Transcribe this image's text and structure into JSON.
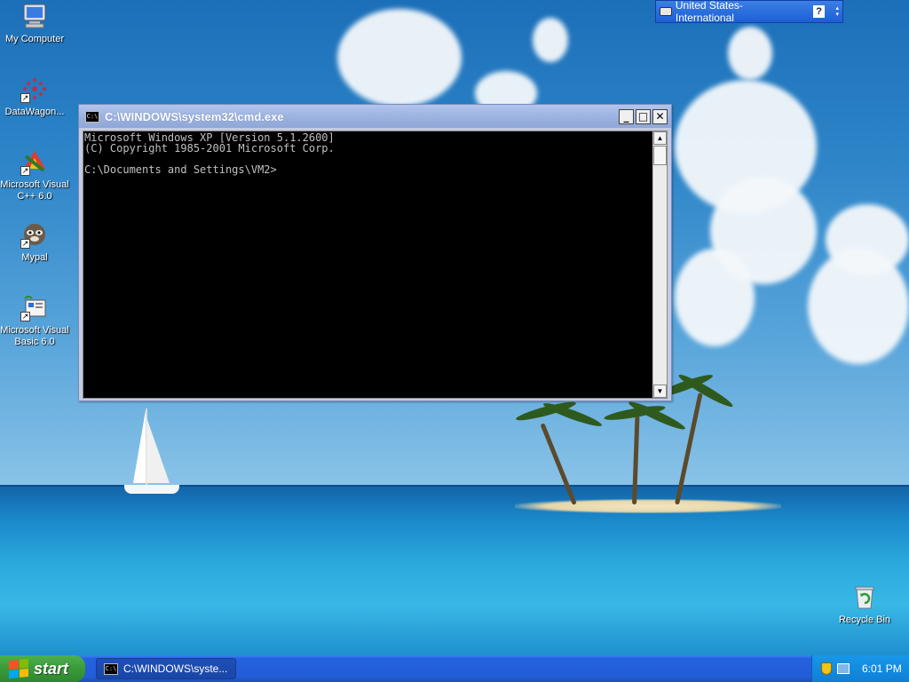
{
  "desktop": {
    "icons": [
      {
        "label": "My Computer",
        "icon": "computer-icon"
      },
      {
        "label": "DataWagon...",
        "icon": "datawagon-icon"
      },
      {
        "label": "Microsoft Visual C++ 6.0",
        "icon": "visual-cpp-icon"
      },
      {
        "label": "Mypal",
        "icon": "mypal-icon"
      },
      {
        "label": "Microsoft Visual Basic 6.0",
        "icon": "visual-basic-icon"
      }
    ],
    "recycle_bin": {
      "label": "Recycle Bin",
      "icon": "recycle-bin-icon"
    }
  },
  "language_bar": {
    "language": "United States-International",
    "help": "?"
  },
  "cmd_window": {
    "title": "C:\\WINDOWS\\system32\\cmd.exe",
    "title_icon_text": "C:\\",
    "buttons": {
      "minimize": "_",
      "maximize": "□",
      "close": "✕"
    },
    "console_lines": [
      "Microsoft Windows XP [Version 5.1.2600]",
      "(C) Copyright 1985-2001 Microsoft Corp.",
      "",
      "C:\\Documents and Settings\\VM2>"
    ]
  },
  "taskbar": {
    "start_label": "start",
    "task_button": "C:\\WINDOWS\\syste...",
    "clock": "6:01 PM",
    "colors": {
      "taskbar": "#235dd8",
      "start": "#3a9a3a",
      "tray": "#0f7fd6"
    }
  }
}
